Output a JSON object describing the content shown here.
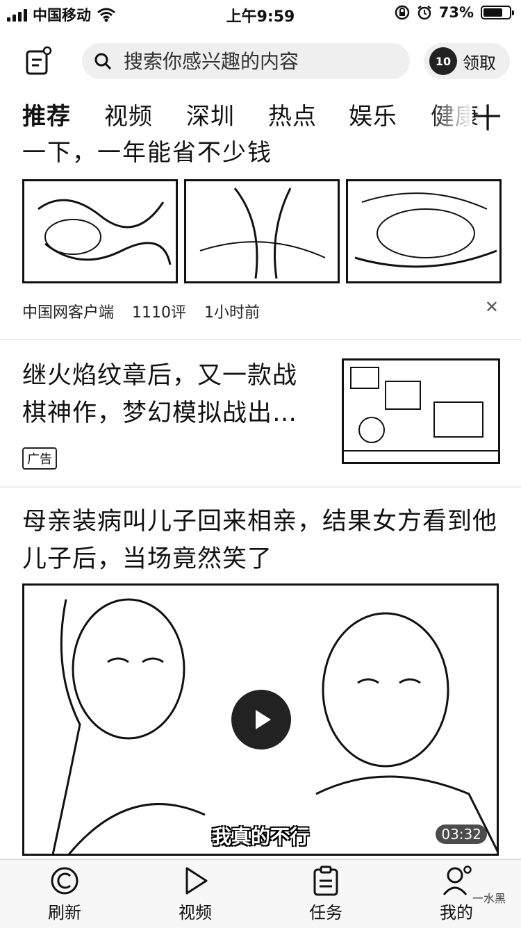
{
  "status_bar": {
    "carrier": "中国移动",
    "time": "上午9:59",
    "battery": "73%",
    "battery_level": 0.73
  },
  "header": {
    "search_placeholder": "搜索你感兴趣的内容",
    "reward_coin": "10",
    "reward_label": "领取"
  },
  "tabs": [
    "推荐",
    "视频",
    "深圳",
    "热点",
    "娱乐",
    "健康"
  ],
  "tab_add": "十",
  "feed": {
    "article1": {
      "title": "一下，一年能省不少钱",
      "source": "中国网客户端",
      "comments": "1110评",
      "time": "1小时前",
      "dismiss": "✕"
    },
    "ad": {
      "title": "继火焰纹章后，又一款战棋神作，梦幻模拟战出…",
      "badge": "广告"
    },
    "video": {
      "title": "母亲装病叫儿子回来相亲，结果女方看到他儿子后，当场竟然笑了",
      "subtitle": "我真的不行",
      "duration": "03:32"
    }
  },
  "bottom_nav": {
    "items": [
      {
        "label": "刷新",
        "icon": "refresh-icon"
      },
      {
        "label": "视频",
        "icon": "play-icon"
      },
      {
        "label": "任务",
        "icon": "task-icon"
      },
      {
        "label": "我的",
        "icon": "profile-icon"
      }
    ],
    "watermark": "一水黑"
  }
}
